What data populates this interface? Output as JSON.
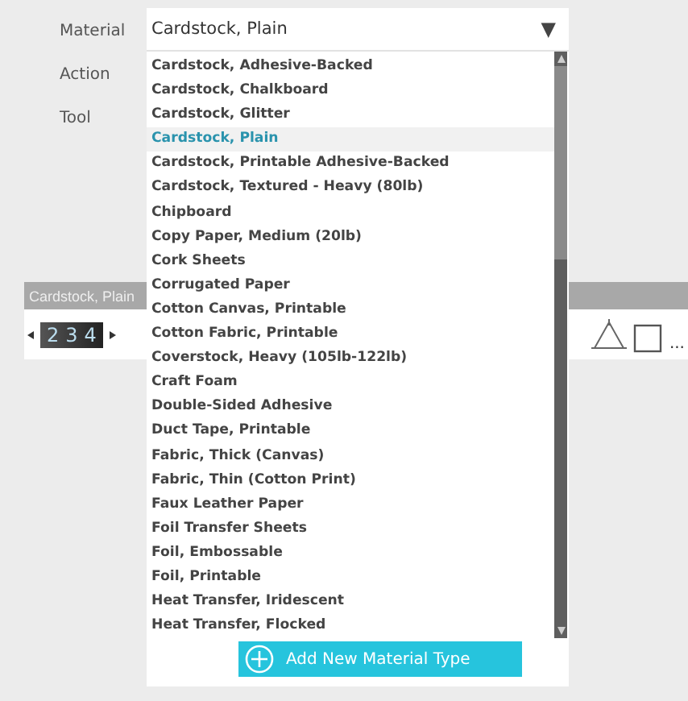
{
  "labels": [
    "Material",
    "Action",
    "Tool"
  ],
  "material_select": {
    "value": "Cardstock, Plain",
    "caret": "▼"
  },
  "material_list": [
    {
      "label": "Cardstock, Adhesive-Backed",
      "selected": false
    },
    {
      "label": "Cardstock, Chalkboard",
      "selected": false
    },
    {
      "label": "Cardstock, Glitter",
      "selected": false
    },
    {
      "label": "Cardstock, Plain",
      "selected": true
    },
    {
      "label": "Cardstock, Printable Adhesive-Backed",
      "selected": false
    },
    {
      "label": "Cardstock, Textured - Heavy (80lb)",
      "selected": false
    },
    {
      "label": "Chipboard",
      "selected": false
    },
    {
      "label": "Copy Paper, Medium (20lb)",
      "selected": false
    },
    {
      "label": "Cork Sheets",
      "selected": false
    },
    {
      "label": "Corrugated Paper",
      "selected": false
    },
    {
      "label": "Cotton Canvas, Printable",
      "selected": false
    },
    {
      "label": "Cotton Fabric, Printable",
      "selected": false
    },
    {
      "label": "Coverstock, Heavy (105lb-122lb)",
      "selected": false
    },
    {
      "label": "Craft Foam",
      "selected": false
    },
    {
      "label": "Double-Sided Adhesive",
      "selected": false
    },
    {
      "label": "Duct Tape, Printable",
      "selected": false
    },
    {
      "label": "Fabric, Thick (Canvas)",
      "selected": false
    },
    {
      "label": "Fabric, Thin (Cotton Print)",
      "selected": false
    },
    {
      "label": "Faux Leather Paper",
      "selected": false
    },
    {
      "label": "Foil Transfer Sheets",
      "selected": false
    },
    {
      "label": "Foil, Embossable",
      "selected": false
    },
    {
      "label": "Foil, Printable",
      "selected": false
    },
    {
      "label": "Heat Transfer, Iridescent",
      "selected": false
    },
    {
      "label": "Heat Transfer, Flocked",
      "selected": false
    }
  ],
  "add_button": {
    "label": "Add New Material Type"
  },
  "background_bar": {
    "title": "Cardstock, Plain",
    "digits": [
      "2",
      "3",
      "4"
    ],
    "more": "..."
  }
}
